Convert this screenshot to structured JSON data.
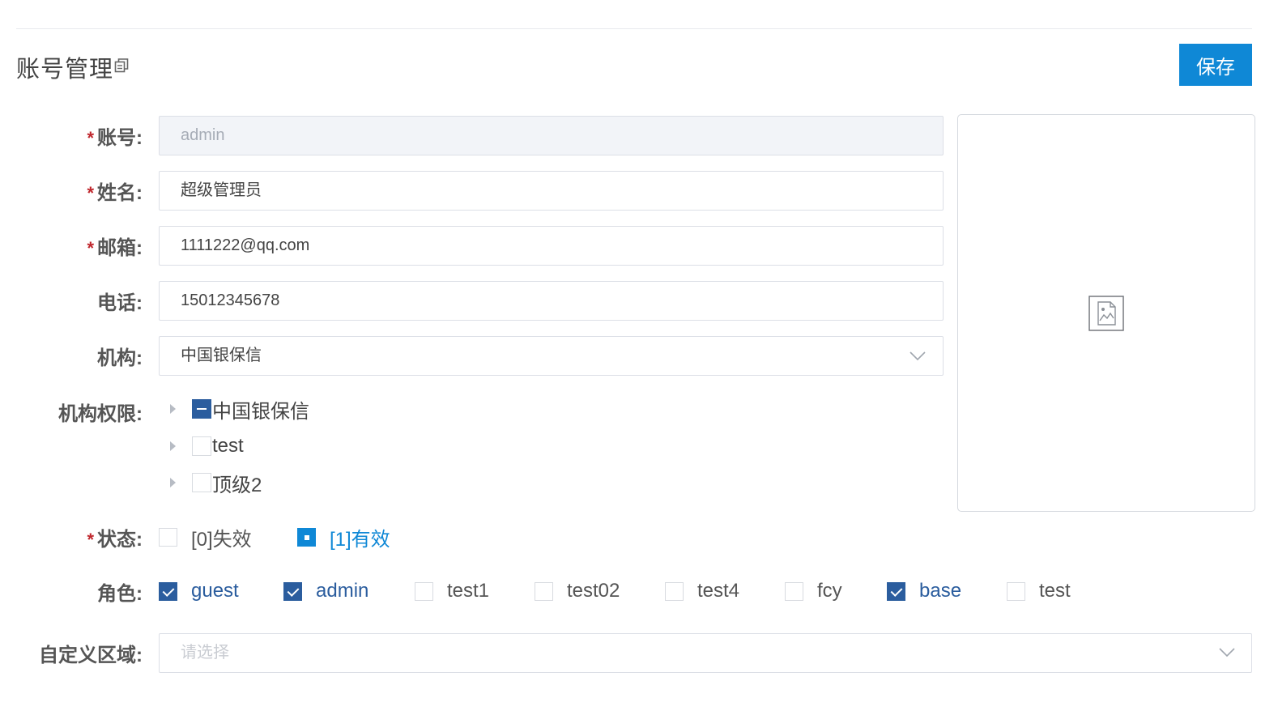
{
  "header": {
    "title": "账号管理",
    "title_icon": "copy-icon",
    "save_label": "保存"
  },
  "colors": {
    "accent": "#0f88d6",
    "checkbox_checked": "#2b5d9e",
    "required_mark": "#c0282e"
  },
  "form": {
    "required_mark": "*",
    "account": {
      "label": "账号:",
      "value": "admin",
      "disabled": true
    },
    "name": {
      "label": "姓名:",
      "value": "超级管理员"
    },
    "email": {
      "label": "邮箱:",
      "value": "1111222@qq.com"
    },
    "phone": {
      "label": "电话:",
      "value": "15012345678"
    },
    "org": {
      "label": "机构:",
      "value": "中国银保信",
      "icon": "chevron-down-icon"
    },
    "org_permissions": {
      "label": "机构权限:",
      "items": [
        {
          "label": "中国银保信",
          "state": "partial"
        },
        {
          "label": "test",
          "state": "unchecked"
        },
        {
          "label": "顶级2",
          "state": "unchecked"
        }
      ]
    },
    "status": {
      "label": "状态:",
      "options": [
        {
          "label": "[0]失效",
          "selected": false
        },
        {
          "label": "[1]有效",
          "selected": true
        }
      ]
    },
    "roles": {
      "label": "角色:",
      "options": [
        {
          "label": "guest",
          "checked": true
        },
        {
          "label": "admin",
          "checked": true
        },
        {
          "label": "test1",
          "checked": false
        },
        {
          "label": "test02",
          "checked": false
        },
        {
          "label": "test4",
          "checked": false
        },
        {
          "label": "fcy",
          "checked": false
        },
        {
          "label": "base",
          "checked": true
        },
        {
          "label": "test",
          "checked": false
        }
      ]
    },
    "custom_area": {
      "label": "自定义区域:",
      "placeholder": "请选择",
      "icon": "chevron-down-icon"
    }
  },
  "preview": {
    "icon": "broken-image-icon"
  }
}
